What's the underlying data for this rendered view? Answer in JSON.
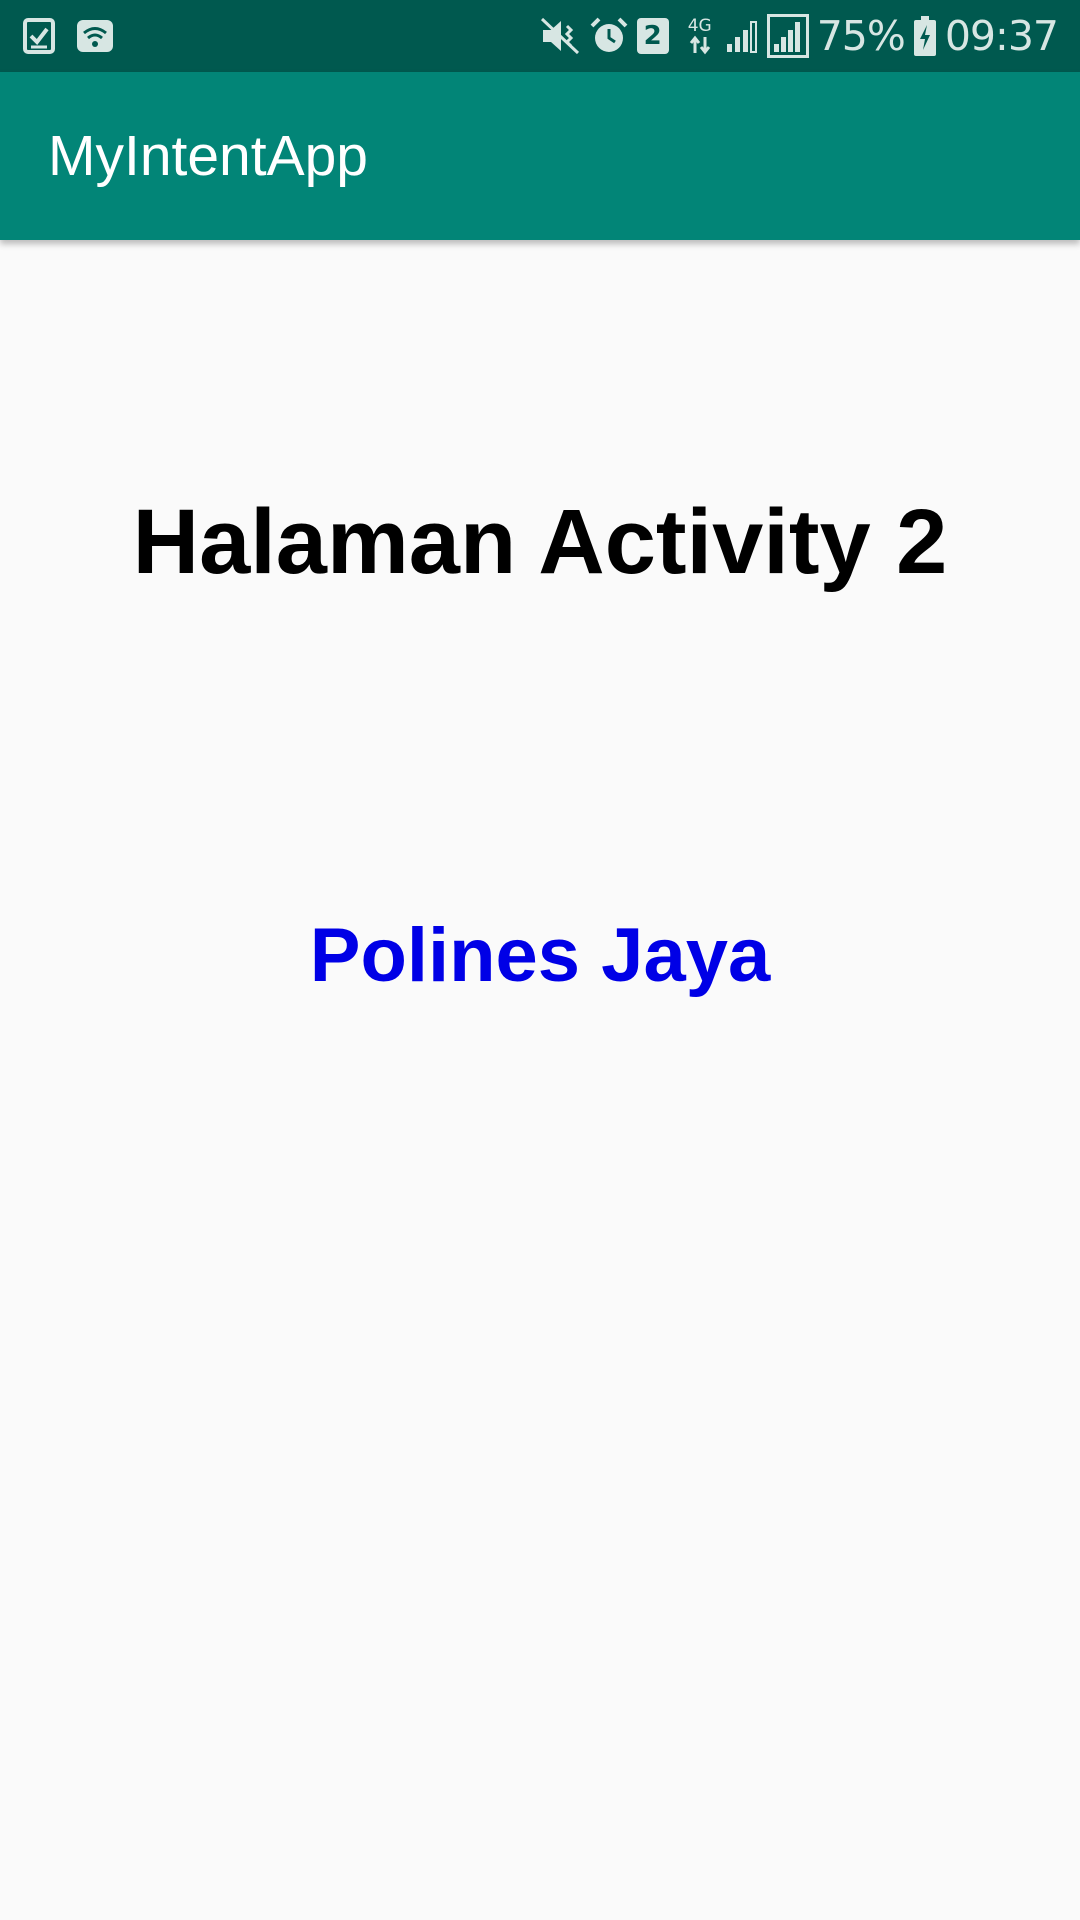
{
  "status_bar": {
    "battery_percent": "75%",
    "time": "09:37",
    "sim_slot": "2",
    "network_type": "4G",
    "left_icons": [
      "task-check-icon",
      "wifi-icon"
    ],
    "right_icons": [
      "vibrate-mute-icon",
      "alarm-icon",
      "sim-2-icon",
      "data-arrows-icon",
      "signal-weak-icon",
      "signal-strong-icon",
      "battery-charging-icon"
    ],
    "background_color": "#00594f"
  },
  "app_bar": {
    "title": "MyIntentApp",
    "background_color": "#028577"
  },
  "main": {
    "heading": "Halaman Activity 2",
    "subtext": "Polines Jaya",
    "subtext_color": "#0000e6"
  }
}
